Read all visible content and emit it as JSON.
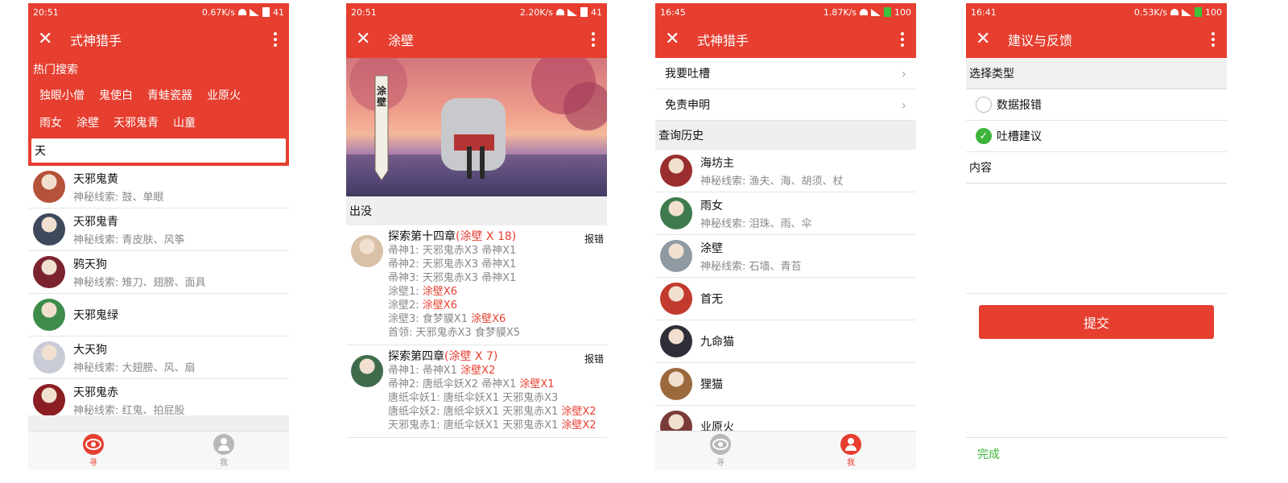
{
  "colors": {
    "accent": "#e63e2f",
    "green": "#3cb43c",
    "hint": "#888888"
  },
  "p1": {
    "status": {
      "time": "20:51",
      "speed": "0.67K/s",
      "battery": "41"
    },
    "title": "式神猎手",
    "hot_label": "热门搜索",
    "tags": [
      "独眼小僧",
      "鬼使白",
      "青蛙瓷器",
      "业原火",
      "雨女",
      "涂壁",
      "天邪鬼青",
      "山童"
    ],
    "search_value": "天",
    "results": [
      {
        "name": "天邪鬼黄",
        "hint": "神秘线索: 鼓、单眼",
        "color": "#b5523a"
      },
      {
        "name": "天邪鬼青",
        "hint": "神秘线索: 青皮肤、风筝",
        "color": "#3e4a5c"
      },
      {
        "name": "鸦天狗",
        "hint": "神秘线索: 雉刀、翅膀、面具",
        "color": "#7b2430"
      },
      {
        "name": "天邪鬼绿",
        "hint": "",
        "color": "#3e8c4a"
      },
      {
        "name": "大天狗",
        "hint": "神秘线索: 大翅膀、风、扇",
        "color": "#c9ccd6"
      },
      {
        "name": "天邪鬼赤",
        "hint": "神秘线索: 红鬼、拍屁股",
        "color": "#8a1e22"
      }
    ],
    "tabs": [
      {
        "label": "寻",
        "icon": "eye-icon"
      },
      {
        "label": "我",
        "icon": "user-icon"
      }
    ]
  },
  "p2": {
    "status": {
      "time": "20:51",
      "speed": "2.20K/s",
      "battery": "41"
    },
    "title": "涂壁",
    "banner_label": "涂壁",
    "section": "出没",
    "entries": [
      {
        "title": "探索第十四章",
        "count": "(涂壁 X 18)",
        "report": "报错",
        "color": "#d9c1a8",
        "lines": [
          [
            "帚神1: 天邪鬼赤X3 帚神X1",
            ""
          ],
          [
            "帚神2: 天邪鬼赤X3 帚神X1",
            ""
          ],
          [
            "帚神3: 天邪鬼赤X3 帚神X1",
            ""
          ],
          [
            "涂壁1: ",
            "涂壁X6"
          ],
          [
            "涂壁2: ",
            "涂壁X6"
          ],
          [
            "涂壁3: 食梦貘X1 ",
            "涂壁X6"
          ],
          [
            "首领: 天邪鬼赤X3 食梦貘X5",
            ""
          ]
        ]
      },
      {
        "title": "探索第四章",
        "count": "(涂壁 X 7)",
        "report": "报错",
        "color": "#3f6b4a",
        "lines": [
          [
            "帚神1: 帚神X1 ",
            "涂壁X2"
          ],
          [
            "帚神2: 唐纸伞妖X2 帚神X1 ",
            "涂壁X1"
          ],
          [
            "唐纸伞妖1: 唐纸伞妖X1 天邪鬼赤X3",
            ""
          ],
          [
            "唐纸伞妖2: 唐纸伞妖X1 天邪鬼赤X1 ",
            "涂壁X2"
          ],
          [
            "天邪鬼赤1: 唐纸伞妖X1 天邪鬼赤X1 ",
            "涂壁X2"
          ]
        ]
      }
    ]
  },
  "p3": {
    "status": {
      "time": "16:45",
      "speed": "1.87K/s",
      "battery": "100"
    },
    "title": "式神猎手",
    "menu": [
      "我要吐槽",
      "免责申明"
    ],
    "history_label": "查询历史",
    "history": [
      {
        "name": "海坊主",
        "hint": "神秘线索: 渔夫、海、胡须、杖",
        "color": "#9a2d2d"
      },
      {
        "name": "雨女",
        "hint": "神秘线索: 泪珠、雨、伞",
        "color": "#3f7a4f"
      },
      {
        "name": "涂壁",
        "hint": "神秘线索: 石墙、青苔",
        "color": "#8f9aa3"
      },
      {
        "name": "首无",
        "hint": "",
        "color": "#c23a2e"
      },
      {
        "name": "九命猫",
        "hint": "",
        "color": "#2e2e38"
      },
      {
        "name": "狸猫",
        "hint": "",
        "color": "#9a6a3c"
      },
      {
        "name": "业原火",
        "hint": "",
        "color": "#7a3a3a"
      }
    ],
    "tabs": [
      {
        "label": "寻",
        "icon": "eye-icon"
      },
      {
        "label": "我",
        "icon": "user-icon"
      }
    ]
  },
  "p4": {
    "status": {
      "time": "16:41",
      "speed": "0.53K/s",
      "battery": "100"
    },
    "title": "建议与反馈",
    "type_label": "选择类型",
    "options": [
      {
        "label": "数据报错",
        "checked": false
      },
      {
        "label": "吐槽建议",
        "checked": true
      }
    ],
    "content_label": "内容",
    "submit": "提交",
    "done": "完成"
  }
}
